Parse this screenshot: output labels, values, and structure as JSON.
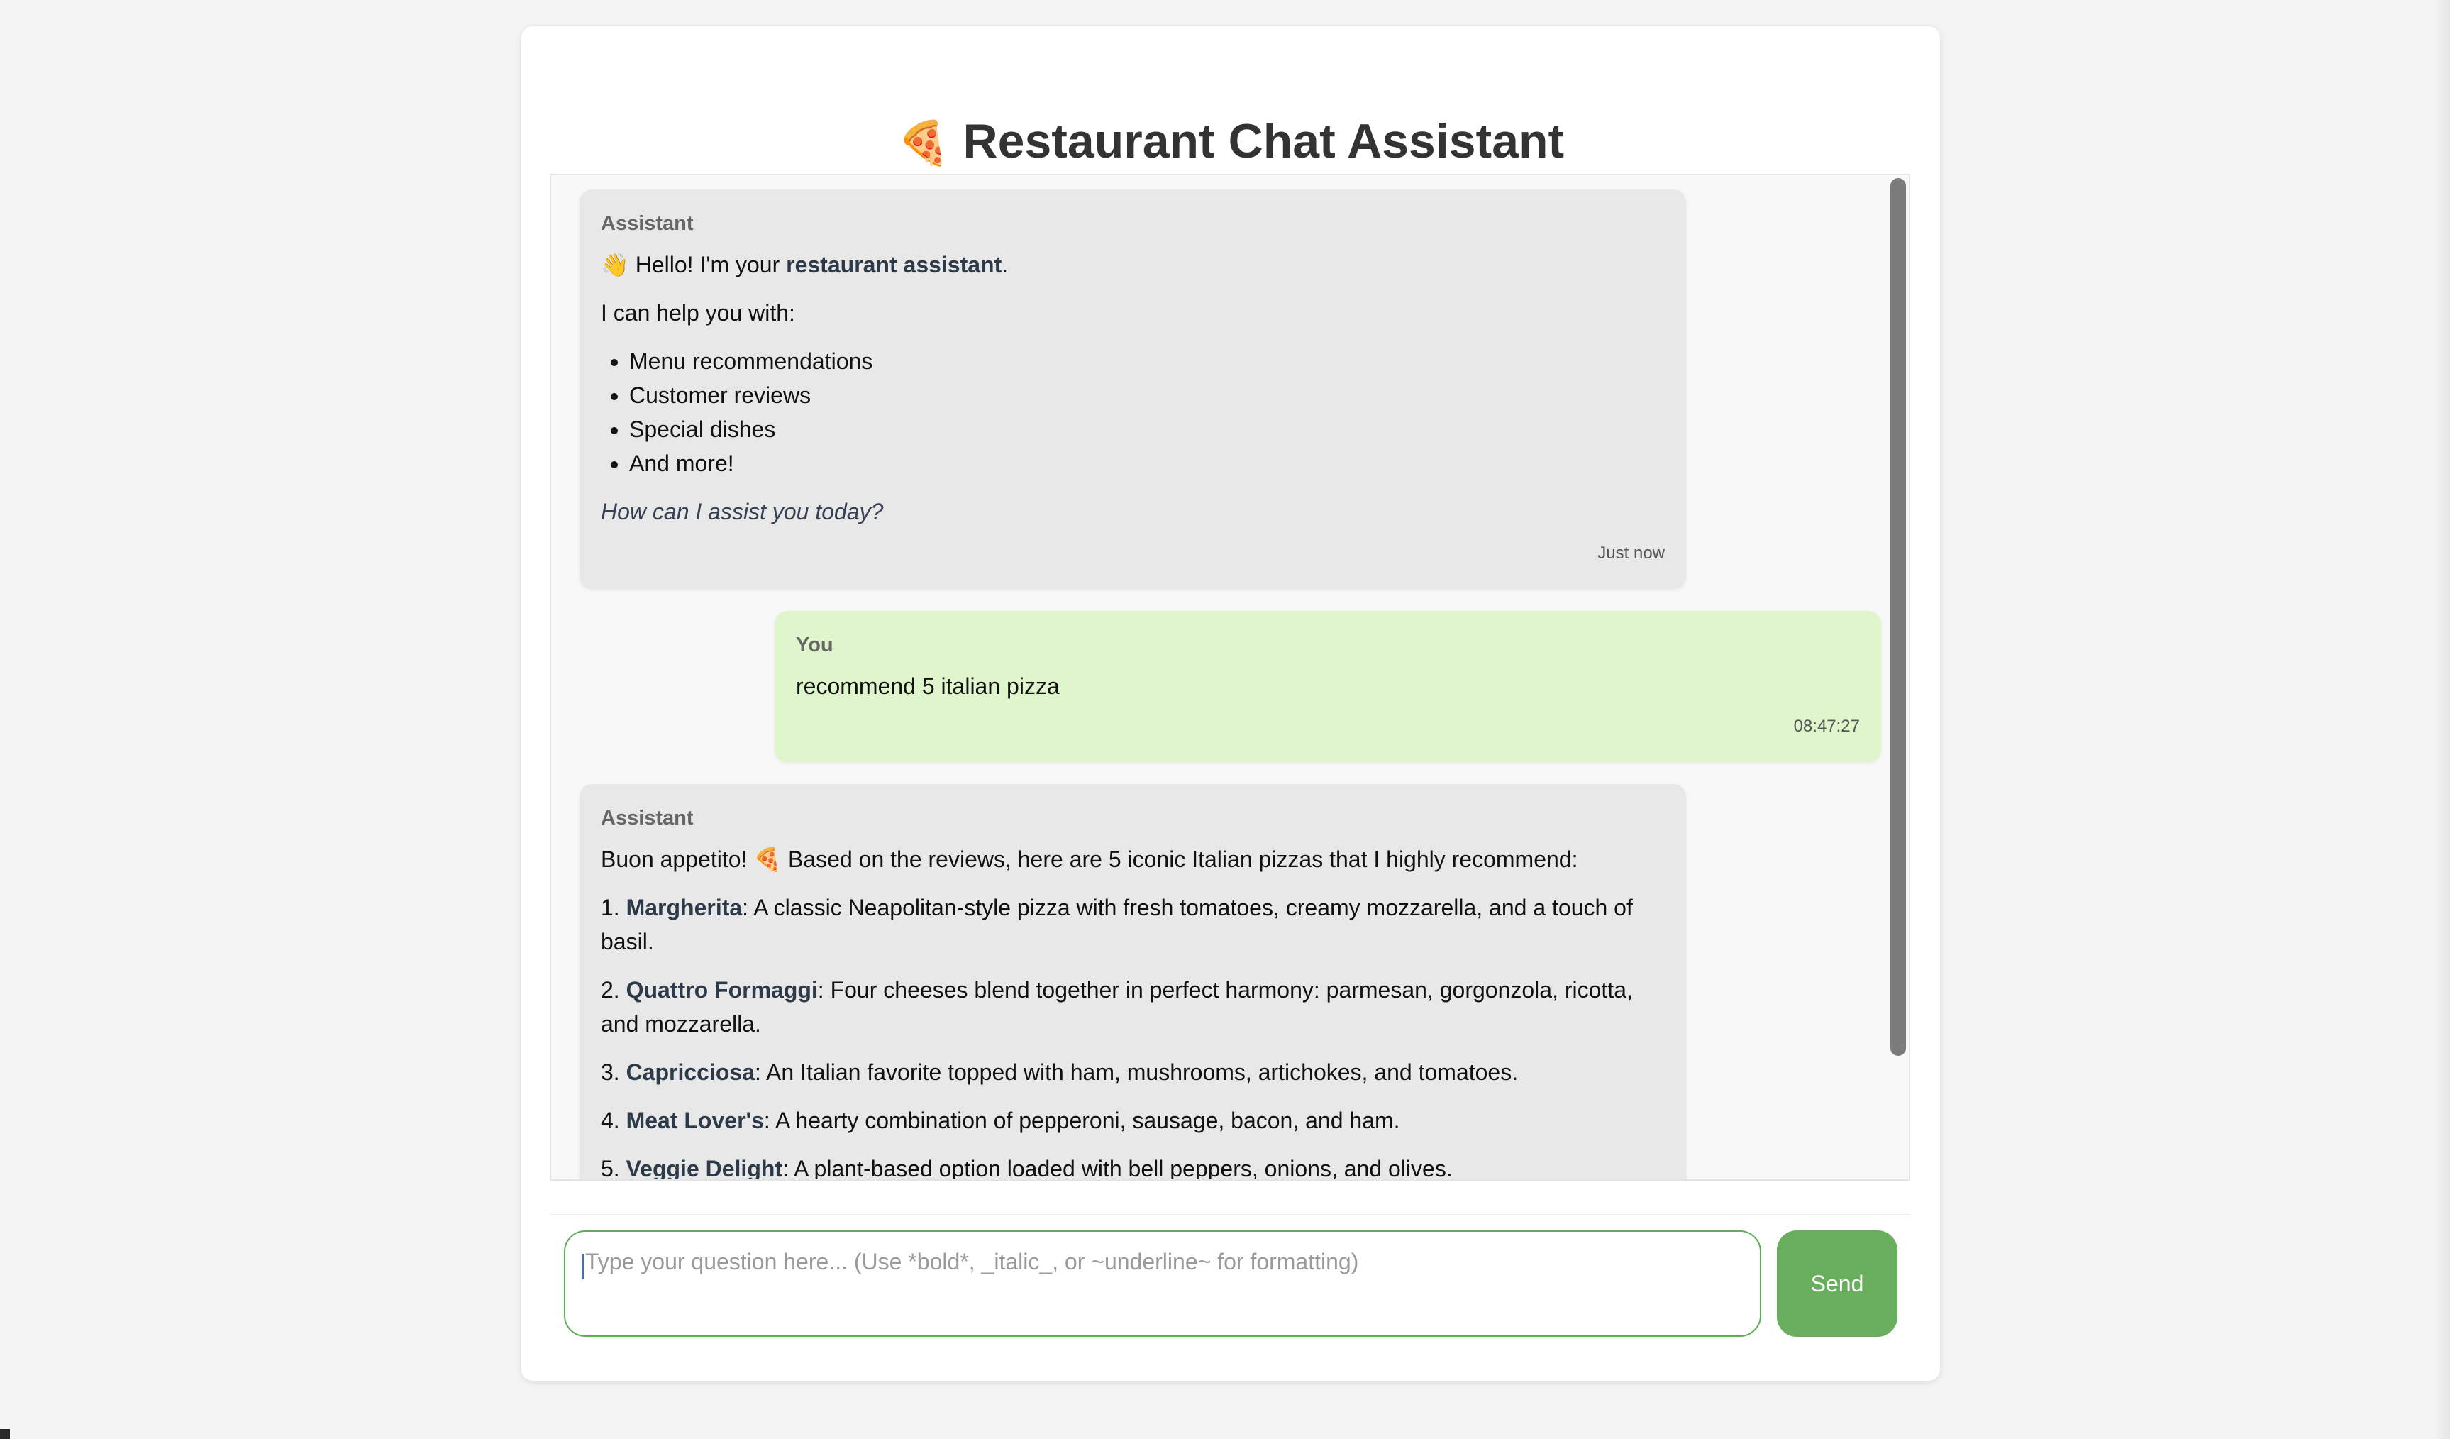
{
  "header": {
    "icon": "🍕",
    "title": "Restaurant Chat Assistant"
  },
  "messages": [
    {
      "sender": "Assistant",
      "greeting_emoji": "👋",
      "greeting_text_before": "Hello! I'm your",
      "greeting_bold": "restaurant assistant",
      "greeting_after": ".",
      "intro": "I can help you with:",
      "items": [
        "Menu recommendations",
        "Customer reviews",
        "Special dishes",
        "And more!"
      ],
      "closing": "How can I assist you today?",
      "time": "Just now"
    },
    {
      "sender": "You",
      "text": "recommend 5 italian pizza",
      "time": "08:47:27"
    },
    {
      "sender": "Assistant",
      "intro_before": "Buon appetito!",
      "intro_emoji": "🍕",
      "intro_after": "Based on the reviews, here are 5 iconic Italian pizzas that I highly recommend:",
      "pizzas": [
        {
          "num": "1.",
          "name": "Margherita",
          "desc": ": A classic Neapolitan-style pizza with fresh tomatoes, creamy mozzarella, and a touch of basil."
        },
        {
          "num": "2.",
          "name": "Quattro Formaggi",
          "desc": ": Four cheeses blend together in perfect harmony: parmesan, gorgonzola, ricotta, and mozzarella."
        },
        {
          "num": "3.",
          "name": "Capricciosa",
          "desc": ": An Italian favorite topped with ham, mushrooms, artichokes, and tomatoes."
        },
        {
          "num": "4.",
          "name": "Meat Lover's",
          "desc": ": A hearty combination of pepperoni, sausage, bacon, and ham."
        },
        {
          "num": "5.",
          "name": "Veggie Delight",
          "desc": ": A plant-based option loaded with bell peppers, onions, and olives."
        }
      ]
    }
  ],
  "composer": {
    "placeholder": "Type your question here... (Use *bold*, _italic_, or ~underline~ for formatting)",
    "send_label": "Send"
  },
  "colors": {
    "assistant_bubble": "#e8e8e8",
    "user_bubble": "#dff6cc",
    "accent_green": "#68ae5d"
  }
}
